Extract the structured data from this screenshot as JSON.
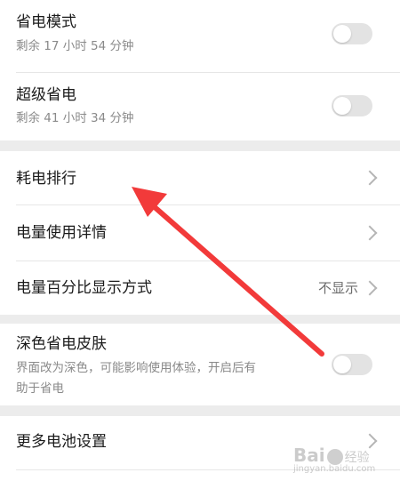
{
  "settings": {
    "power_saving": {
      "title": "省电模式",
      "subtitle": "剩余 17 小时 54 分钟",
      "enabled": false
    },
    "ultra_power_saving": {
      "title": "超级省电",
      "subtitle": "剩余 41 小时 34 分钟",
      "enabled": false
    },
    "consumption_ranking": {
      "title": "耗电排行"
    },
    "usage_details": {
      "title": "电量使用详情"
    },
    "percentage_display": {
      "title": "电量百分比显示方式",
      "value": "不显示"
    },
    "dark_theme": {
      "title": "深色省电皮肤",
      "subtitle_line1": "界面改为深色，可能影响使用体验，开启后有",
      "subtitle_line2": "助于省电",
      "enabled": false
    },
    "more_battery": {
      "title": "更多电池设置"
    }
  },
  "watermark": {
    "brand": "Bai",
    "brand2": "经验",
    "domain": "jingyan.baidu.com"
  },
  "colors": {
    "annotation_arrow": "#f23a3a",
    "toggle_off": "#e3e3e3",
    "section_gap": "#ececec"
  }
}
